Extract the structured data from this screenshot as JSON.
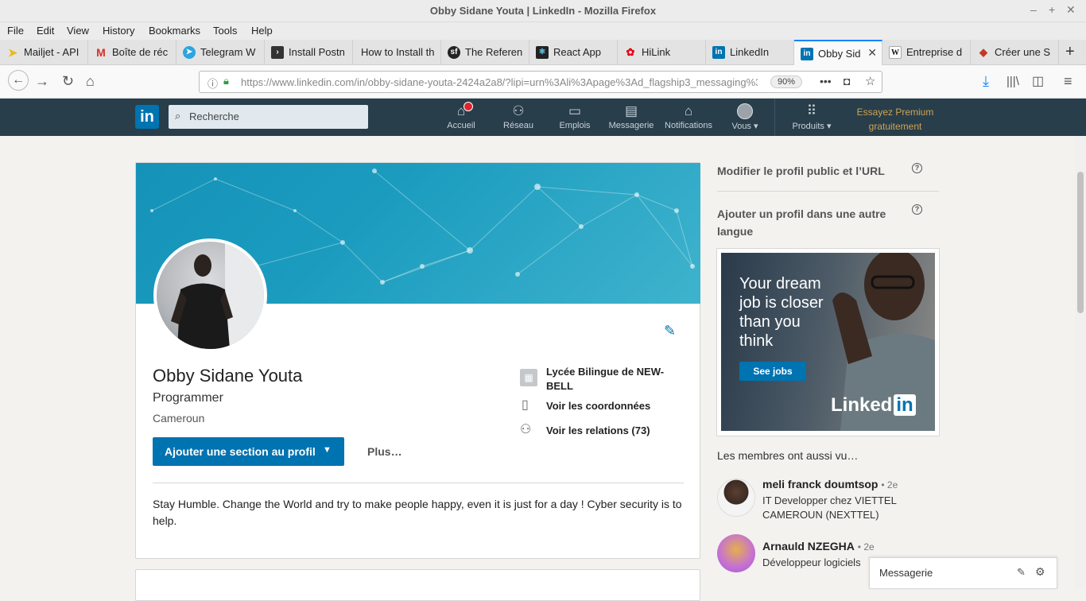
{
  "window": {
    "title": "Obby Sidane Youta | LinkedIn - Mozilla Firefox"
  },
  "menu": [
    "File",
    "Edit",
    "View",
    "History",
    "Bookmarks",
    "Tools",
    "Help"
  ],
  "tabs": [
    {
      "label": "Mailjet - API",
      "icon": "mailjet-icon",
      "color": "#f0b81a"
    },
    {
      "label": "Boîte de réc",
      "icon": "gmail-icon",
      "color": "#d93025"
    },
    {
      "label": "Telegram W",
      "icon": "telegram-icon",
      "color": "#2ca5e0"
    },
    {
      "label": "Install Postn",
      "icon": "terminal-icon",
      "color": "#333333"
    },
    {
      "label": "How to Install th",
      "icon": "",
      "color": ""
    },
    {
      "label": "The Referen",
      "icon": "symfony-icon",
      "color": "#222222"
    },
    {
      "label": "React App",
      "icon": "react-icon",
      "color": "#222222"
    },
    {
      "label": "HiLink",
      "icon": "huawei-icon",
      "color": "#e60012"
    },
    {
      "label": "LinkedIn",
      "icon": "linkedin-icon",
      "color": "#0073b1"
    },
    {
      "label": "Obby Sid",
      "icon": "linkedin-icon",
      "color": "#0073b1",
      "active": true
    },
    {
      "label": "Entreprise d",
      "icon": "wikipedia-icon",
      "color": "#ffffff"
    },
    {
      "label": "Créer une S",
      "icon": "page-icon",
      "color": "#c0392b"
    }
  ],
  "address": {
    "url": "https://www.linkedin.com/in/obby-sidane-youta-2424a2a8/?lipi=urn%3Ali%3Apage%3Ad_flagship3_messaging%3",
    "zoom": "90%"
  },
  "linkedin_nav": {
    "logo": "in",
    "search_placeholder": "Recherche",
    "items": [
      {
        "label": "Accueil",
        "icon": "home-icon"
      },
      {
        "label": "Réseau",
        "icon": "network-icon"
      },
      {
        "label": "Emplois",
        "icon": "briefcase-icon"
      },
      {
        "label": "Messagerie",
        "icon": "messaging-icon"
      },
      {
        "label": "Notifications",
        "icon": "bell-icon"
      },
      {
        "label": "Vous ▾",
        "icon": "avatar-icon"
      },
      {
        "label": "Produits ▾",
        "icon": "grid-icon"
      }
    ],
    "premium_line1": "Essayez Premium",
    "premium_line2": "gratuitement"
  },
  "profile": {
    "name": "Obby Sidane Youta",
    "headline": "Programmer",
    "location": "Cameroun",
    "school": "Lycée Bilingue de NEW-BELL",
    "contact": "Voir les coordonnées",
    "connections": "Voir les relations (73)",
    "add_section": "Ajouter une section au profil",
    "more": "Plus…",
    "summary": "Stay Humble. Change the World and try to make people happy, even it is just for a day ! Cyber security is to help."
  },
  "sidebar": {
    "edit_public": "Modifier le profil public et l’URL",
    "add_language": "Ajouter un profil dans une autre langue",
    "ad_text": "Your dream job is closer than you think",
    "ad_button": "See jobs",
    "ad_brand": "Linked",
    "ad_brand_in": "in",
    "also_viewed": "Les membres ont aussi vu…",
    "members": [
      {
        "name": "meli franck doumtsop",
        "degree": "• 2e",
        "title": "IT Developper chez VIETTEL CAMEROUN (NEXTTEL)"
      },
      {
        "name": "Arnauld NZEGHA",
        "degree": "• 2e",
        "title": "Développeur logiciels"
      }
    ]
  },
  "messaging_bar": {
    "label": "Messagerie"
  }
}
